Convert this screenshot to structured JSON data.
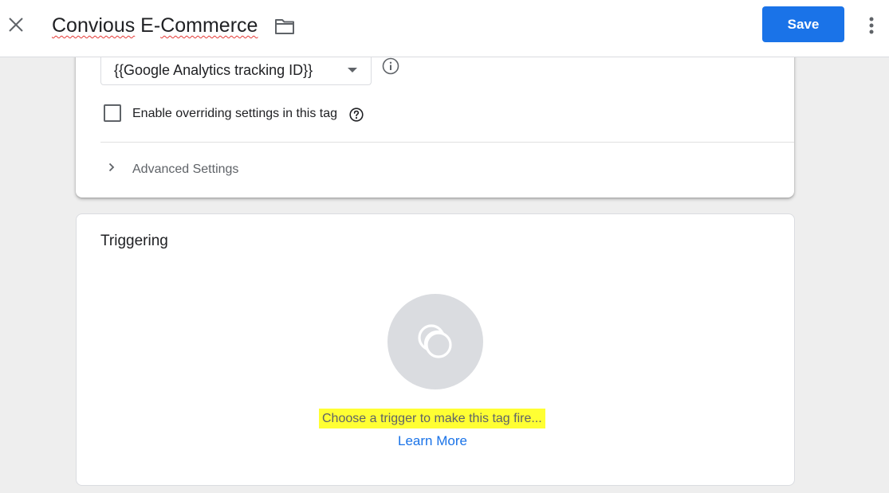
{
  "header": {
    "title_part1": "Convious",
    "title_part2": " E-",
    "title_part3": "Commerce",
    "save_label": "Save",
    "close_icon": "close-icon",
    "folder_icon": "folder-icon",
    "more_icon": "more-vert-icon"
  },
  "config": {
    "tracking_select_value": "{{Google Analytics tracking ID}}",
    "override_checkbox_label": "Enable overriding settings in this tag",
    "override_checked": false,
    "advanced_settings_label": "Advanced Settings"
  },
  "triggering": {
    "heading": "Triggering",
    "hint": "Choose a trigger to make this tag fire...",
    "learn_more": "Learn More"
  },
  "colors": {
    "accent": "#1a73e8",
    "highlight": "#ffff33",
    "background": "#eeeeee"
  }
}
